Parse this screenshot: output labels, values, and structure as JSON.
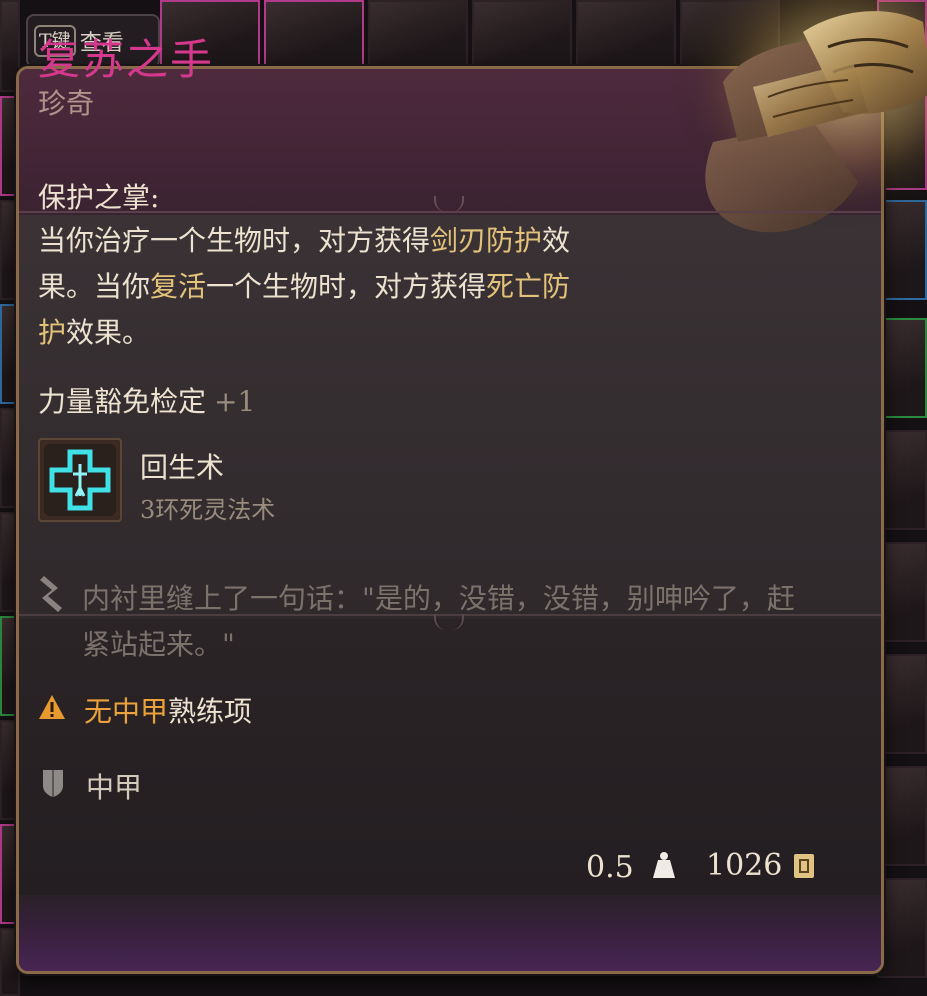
{
  "hint": {
    "key": "T键",
    "label": "查看"
  },
  "item": {
    "name": "复苏之手",
    "rarity": "珍奇",
    "accent_color": "#d6388e"
  },
  "passive": {
    "name": "保护之掌:",
    "desc_parts": [
      "当你治疗一个生物时，对方获得",
      "剑刃防护",
      "效果。当你",
      "复活",
      "一个生物时，对方获得",
      "死亡防护",
      "效果。"
    ]
  },
  "bonus": {
    "label": "力量豁免检定",
    "value": "+1"
  },
  "spell": {
    "name": "回生术",
    "level": "3环死灵法术",
    "icon": "resurrection-cross-icon"
  },
  "flavor": "内衬里缝上了一句话：\"是的，没错，没错，别呻吟了，赶紧站起来。\"",
  "warning": {
    "highlight": "无中甲",
    "rest": "熟练项",
    "color": "#eba23c"
  },
  "armor": {
    "type": "中甲",
    "icon": "shield-icon"
  },
  "footer": {
    "weight": "0.5",
    "value": "1026"
  }
}
